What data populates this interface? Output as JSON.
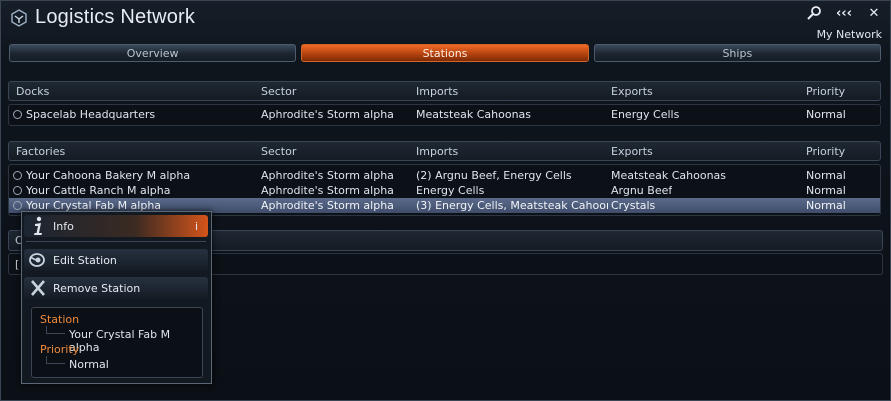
{
  "window": {
    "title": "Logistics Network",
    "subtitle": "My Network",
    "controls": [
      {
        "name": "search-icon",
        "label": "⚲"
      },
      {
        "name": "back-icon",
        "label": "‹‹‹"
      },
      {
        "name": "close-icon",
        "label": "✕"
      }
    ]
  },
  "tabs": [
    {
      "label": "Overview",
      "active": false
    },
    {
      "label": "Stations",
      "active": true
    },
    {
      "label": "Ships",
      "active": false
    }
  ],
  "docks": {
    "columns": [
      "Docks",
      "Sector",
      "Imports",
      "Exports",
      "Priority"
    ],
    "rows": [
      [
        "Spacelab Headquarters",
        "Aphrodite's Storm alpha",
        "Meatsteak Cahoonas",
        "Energy Cells",
        "Normal"
      ]
    ]
  },
  "factories": {
    "columns": [
      "Factories",
      "Sector",
      "Imports",
      "Exports",
      "Priority"
    ],
    "rows": [
      [
        "Your Cahoona Bakery M alpha",
        "Aphrodite's Storm alpha",
        "(2) Argnu Beef, Energy Cells",
        "Meatsteak Cahoonas",
        "Normal"
      ],
      [
        "Your Cattle Ranch M alpha",
        "Aphrodite's Storm alpha",
        "Energy Cells",
        "Argnu Beef",
        "Normal"
      ],
      [
        "Your Crystal Fab M alpha",
        "Aphrodite's Storm alpha",
        "(3) Energy Cells, Meatsteak Cahoon...",
        "Crystals",
        "Normal"
      ]
    ],
    "selected_index": 2
  },
  "hidden_section": {
    "header_clip": "O",
    "row_clip": "["
  },
  "context_menu": {
    "items": [
      {
        "label": "Info",
        "shortcut": "i",
        "icon": "info-icon"
      },
      {
        "label": "Edit Station",
        "shortcut": "",
        "icon": "edit-icon"
      },
      {
        "label": "Remove Station",
        "shortcut": "",
        "icon": "remove-icon"
      }
    ],
    "details": {
      "station_label": "Station",
      "station_value": "Your Crystal Fab M alpha",
      "priority_label": "Priority",
      "priority_value": "Normal"
    }
  },
  "colors": {
    "accent": "#d4541a",
    "detail_label": "#f08a3a",
    "selection": "#4a5878"
  }
}
